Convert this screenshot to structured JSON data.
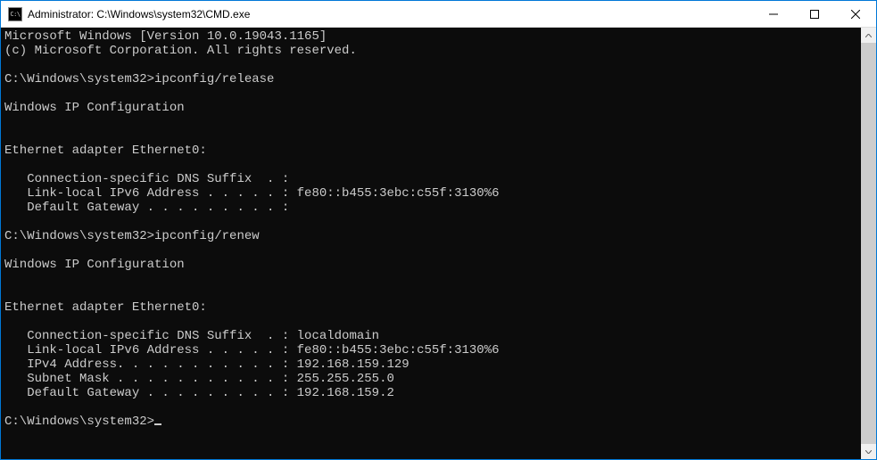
{
  "window": {
    "title": "Administrator: C:\\Windows\\system32\\CMD.exe",
    "icon_label": "C:\\"
  },
  "terminal": {
    "lines": [
      "Microsoft Windows [Version 10.0.19043.1165]",
      "(c) Microsoft Corporation. All rights reserved.",
      "",
      "C:\\Windows\\system32>ipconfig/release",
      "",
      "Windows IP Configuration",
      "",
      "",
      "Ethernet adapter Ethernet0:",
      "",
      "   Connection-specific DNS Suffix  . :",
      "   Link-local IPv6 Address . . . . . : fe80::b455:3ebc:c55f:3130%6",
      "   Default Gateway . . . . . . . . . :",
      "",
      "C:\\Windows\\system32>ipconfig/renew",
      "",
      "Windows IP Configuration",
      "",
      "",
      "Ethernet adapter Ethernet0:",
      "",
      "   Connection-specific DNS Suffix  . : localdomain",
      "   Link-local IPv6 Address . . . . . : fe80::b455:3ebc:c55f:3130%6",
      "   IPv4 Address. . . . . . . . . . . : 192.168.159.129",
      "   Subnet Mask . . . . . . . . . . . : 255.255.255.0",
      "   Default Gateway . . . . . . . . . : 192.168.159.2",
      "",
      "C:\\Windows\\system32>"
    ],
    "prompt_has_cursor": true
  }
}
